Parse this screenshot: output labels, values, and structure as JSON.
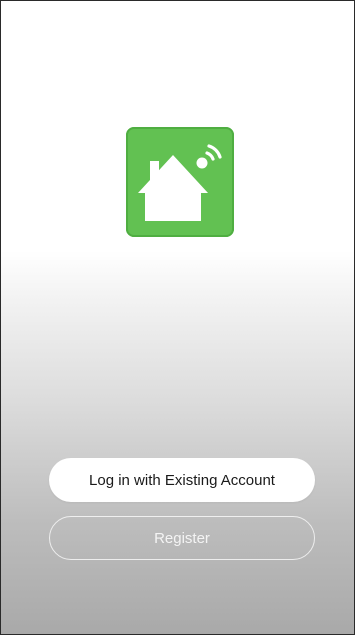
{
  "app": {
    "logo_icon": "smart-home-wifi-icon",
    "brand_color": "#62c152"
  },
  "actions": {
    "login_label": "Log in with Existing Account",
    "register_label": "Register"
  }
}
